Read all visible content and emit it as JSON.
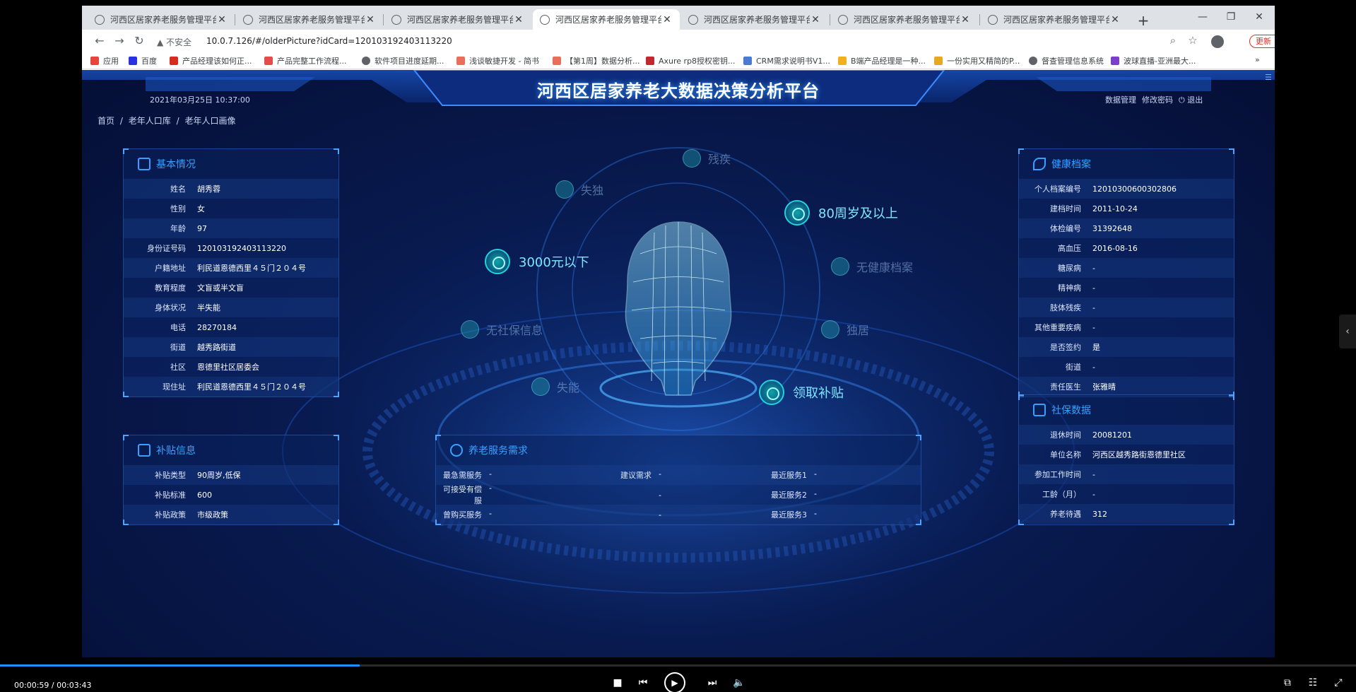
{
  "browser": {
    "tabs": [
      {
        "title": "河西区居家养老服务管理平台",
        "active": false
      },
      {
        "title": "河西区居家养老服务管理平台",
        "active": false
      },
      {
        "title": "河西区居家养老服务管理平台",
        "active": false
      },
      {
        "title": "河西区居家养老服务管理平台",
        "active": true
      },
      {
        "title": "河西区居家养老服务管理平台",
        "active": false
      },
      {
        "title": "河西区居家养老服务管理平台",
        "active": false
      },
      {
        "title": "河西区居家养老服务管理平台",
        "active": false
      }
    ],
    "insecure_label": "不安全",
    "url": "10.0.7.126/#/olderPicture?idCard=120103192403113220",
    "update_label": "更新",
    "bookmarks": [
      "应用",
      "百度",
      "产品经理该如何正...",
      "产品完整工作流程...",
      "软件项目进度延期...",
      "浅谈敏捷开发 - 简书",
      "【第1周】数据分析...",
      "Axure rp8授权密钥...",
      "CRM需求说明书V1...",
      "B端产品经理是一种...",
      "一份实用又精简的P...",
      "督查管理信息系统",
      "波球直播-亚洲最大..."
    ]
  },
  "app": {
    "title": "河西区居家养老大数据决策分析平台",
    "datetime": "2021年03月25日 10:37:00",
    "header_links": {
      "data_manage": "数据管理",
      "change_password": "修改密码",
      "logout": "退出"
    },
    "breadcrumb": [
      "首页",
      "/",
      "老年人口库",
      "/",
      "老年人口画像"
    ],
    "basic_info": {
      "title": "基本情况",
      "rows": [
        {
          "label": "姓名",
          "value": "胡秀蓉"
        },
        {
          "label": "性别",
          "value": "女"
        },
        {
          "label": "年龄",
          "value": "97"
        },
        {
          "label": "身份证号码",
          "value": "120103192403113220"
        },
        {
          "label": "户籍地址",
          "value": "利民道恩德西里４５门２０４号"
        },
        {
          "label": "教育程度",
          "value": "文盲或半文盲"
        },
        {
          "label": "身体状况",
          "value": "半失能"
        },
        {
          "label": "电话",
          "value": "28270184"
        },
        {
          "label": "街道",
          "value": "越秀路街道"
        },
        {
          "label": "社区",
          "value": "恩德里社区居委会"
        },
        {
          "label": "现住址",
          "value": "利民道恩德西里４５门２０４号"
        }
      ]
    },
    "subsidy": {
      "title": "补贴信息",
      "rows": [
        {
          "label": "补贴类型",
          "value": "90周岁,低保"
        },
        {
          "label": "补贴标准",
          "value": "600"
        },
        {
          "label": "补贴政策",
          "value": "市级政策"
        }
      ]
    },
    "needs": {
      "title": "养老服务需求",
      "rows": [
        [
          {
            "label": "最急需服务",
            "value": "-"
          },
          {
            "label": "建议需求",
            "value": "-"
          },
          {
            "label": "最近服务1",
            "value": "-"
          }
        ],
        [
          {
            "label": "可接受有偿服",
            "value": "-"
          },
          {
            "label": "",
            "value": "-"
          },
          {
            "label": "最近服务2",
            "value": "-"
          }
        ],
        [
          {
            "label": "曾购买服务",
            "value": "-"
          },
          {
            "label": "",
            "value": "-"
          },
          {
            "label": "最近服务3",
            "value": "-"
          }
        ]
      ]
    },
    "health": {
      "title": "健康档案",
      "rows": [
        {
          "label": "个人档案编号",
          "value": "12010300600302806"
        },
        {
          "label": "建档时间",
          "value": "2011-10-24"
        },
        {
          "label": "体检编号",
          "value": "31392648"
        },
        {
          "label": "高血压",
          "value": "2016-08-16"
        },
        {
          "label": "糖尿病",
          "value": "-"
        },
        {
          "label": "精神病",
          "value": "-"
        },
        {
          "label": "肢体残疾",
          "value": "-"
        },
        {
          "label": "其他重要疾病",
          "value": "-"
        },
        {
          "label": "是否签约",
          "value": "是"
        },
        {
          "label": "街道",
          "value": "-"
        },
        {
          "label": "责任医生",
          "value": "张雅晴"
        }
      ]
    },
    "social": {
      "title": "社保数据",
      "rows": [
        {
          "label": "退休时间",
          "value": "20081201"
        },
        {
          "label": "单位名称",
          "value": "河西区越秀路街恩德里社区"
        },
        {
          "label": "参加工作时间",
          "value": "-"
        },
        {
          "label": "工龄（月）",
          "value": "-"
        },
        {
          "label": "养老待遇",
          "value": "312"
        }
      ]
    },
    "portrait_tags": {
      "active": [
        "80周岁及以上",
        "3000元以下",
        "领取补贴"
      ],
      "inactive": [
        "残疾",
        "失独",
        "无健康档案",
        "无社保信息",
        "独居",
        "失能"
      ]
    }
  },
  "player": {
    "time": "00:00:59 / 00:03:43",
    "progress": 0.265
  }
}
